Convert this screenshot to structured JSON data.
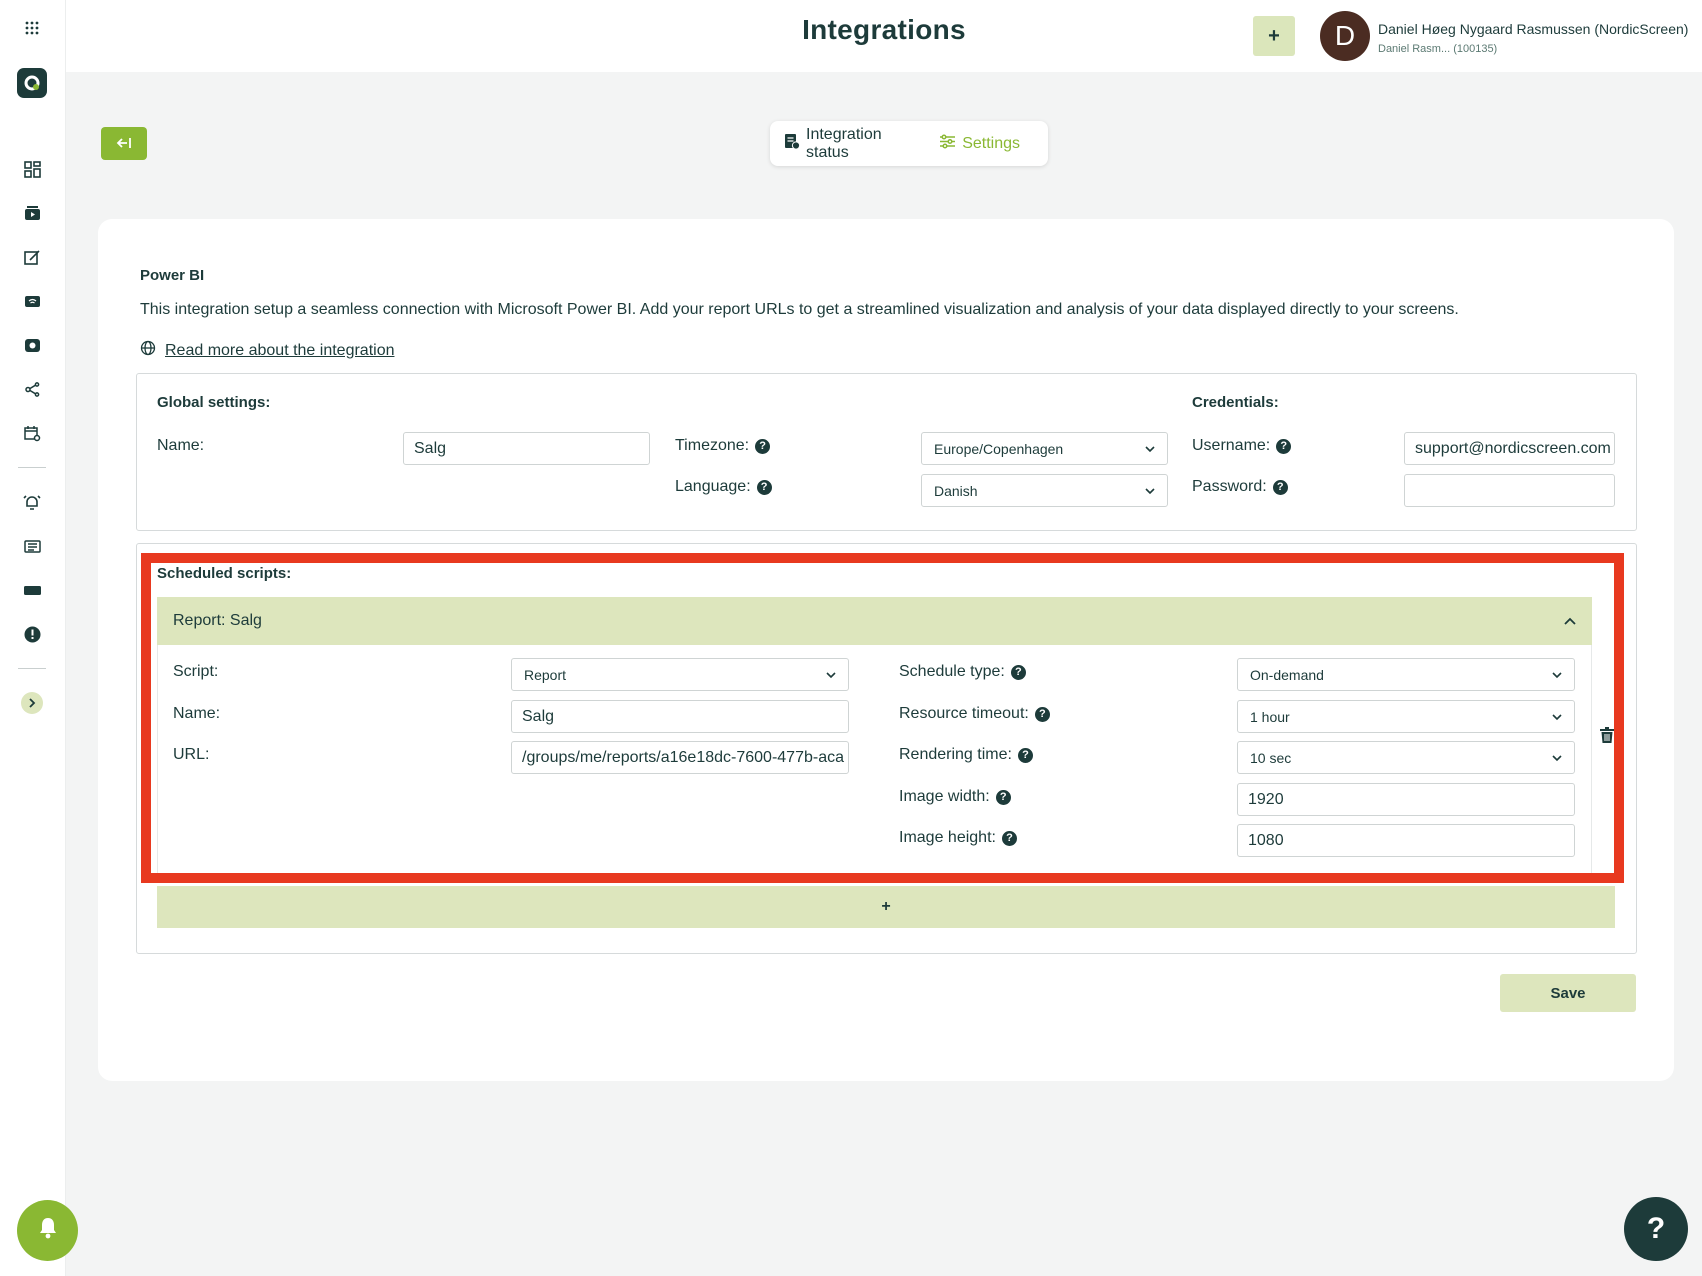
{
  "header": {
    "title": "Integrations",
    "add_label": "+",
    "avatar_letter": "D",
    "user_name": "Daniel Høeg Nygaard Rasmussen (NordicScreen)",
    "user_sub": "Daniel Rasm... (100135)"
  },
  "tabs": [
    {
      "label": "Integration status",
      "icon": "document-status-icon",
      "active": false
    },
    {
      "label": "Settings",
      "icon": "sliders-icon",
      "active": true
    }
  ],
  "integration": {
    "title": "Power BI",
    "description": "This integration setup a seamless connection with Microsoft Power BI. Add your report URLs to get a streamlined visualization and analysis of your data displayed directly to your screens.",
    "read_more": "Read more about the integration"
  },
  "global_settings": {
    "heading": "Global settings:",
    "name_label": "Name:",
    "name_value": "Salg",
    "timezone_label": "Timezone:",
    "timezone_value": "Europe/Copenhagen",
    "language_label": "Language:",
    "language_value": "Danish"
  },
  "credentials": {
    "heading": "Credentials:",
    "username_label": "Username:",
    "username_value": "support@nordicscreen.com",
    "password_label": "Password:",
    "password_value": ""
  },
  "scheduled": {
    "heading": "Scheduled scripts:",
    "report_title": "Report: Salg",
    "script_label": "Script:",
    "script_value": "Report",
    "name_label": "Name:",
    "name_value": "Salg",
    "url_label": "URL:",
    "url_value": "/groups/me/reports/a16e18dc-7600-477b-aca",
    "schedule_type_label": "Schedule type:",
    "schedule_type_value": "On-demand",
    "resource_timeout_label": "Resource timeout:",
    "resource_timeout_value": "1 hour",
    "rendering_time_label": "Rendering time:",
    "rendering_time_value": "10 sec",
    "image_width_label": "Image width:",
    "image_width_value": "1920",
    "image_height_label": "Image height:",
    "image_height_value": "1080",
    "add_label": "+"
  },
  "actions": {
    "save_label": "Save",
    "help_label": "?"
  },
  "colors": {
    "brand_green": "#8ab833",
    "soft_green": "#dde6bd",
    "dark_teal": "#1d3b3a",
    "highlight_red": "#e8391f"
  }
}
